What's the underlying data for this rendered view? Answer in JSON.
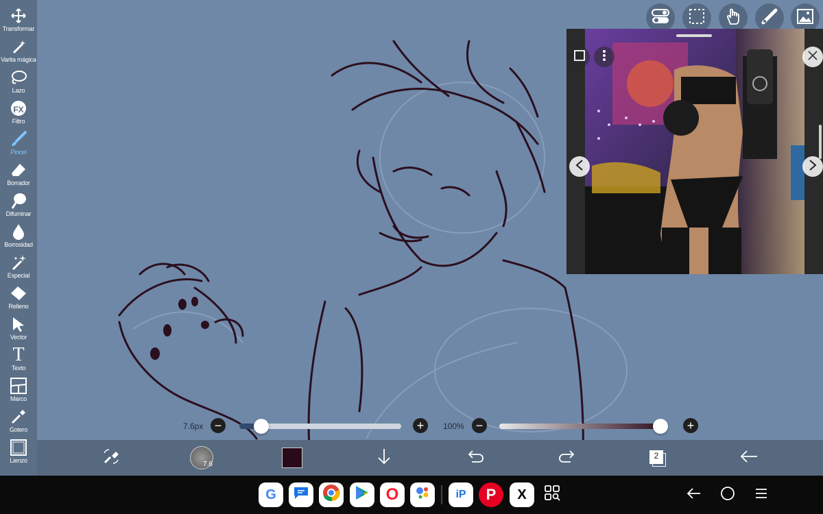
{
  "toolbar": {
    "tools": [
      {
        "label": "Transformar",
        "icon": "move-arrows-icon"
      },
      {
        "label": "Varita mágica",
        "icon": "magic-wand-icon"
      },
      {
        "label": "Lazo",
        "icon": "lasso-icon"
      },
      {
        "label": "Filtro",
        "icon": "fx-icon"
      },
      {
        "label": "Pincel",
        "icon": "brush-icon",
        "active": true
      },
      {
        "label": "Borrador",
        "icon": "eraser-icon"
      },
      {
        "label": "Difuminar",
        "icon": "smudge-icon"
      },
      {
        "label": "Borrosidad",
        "icon": "blur-drop-icon"
      },
      {
        "label": "Especial",
        "icon": "sparkle-icon"
      },
      {
        "label": "Relleno",
        "icon": "fill-bucket-icon"
      },
      {
        "label": "Vector",
        "icon": "vector-arrow-icon"
      },
      {
        "label": "Texto",
        "icon": "text-icon"
      },
      {
        "label": "Marco",
        "icon": "frame-icon"
      },
      {
        "label": "Gotero",
        "icon": "eyedropper-icon"
      },
      {
        "label": "Lienzo",
        "icon": "canvas-icon"
      }
    ],
    "fx_text": "FX",
    "text_glyph": "T"
  },
  "top_tools": [
    "toggle-icon",
    "selection-icon",
    "hand-icon",
    "ruler-icon",
    "image-icon"
  ],
  "sliders": {
    "brush_size": "7.6px",
    "opacity": "100%",
    "brush_size_level": 0.1,
    "opacity_level": 1.0
  },
  "bottombar": {
    "brush_preview_value": "7.6",
    "layer_count": "2",
    "current_color": "#2a0a1a"
  },
  "colors": {
    "toolbar_bg": "#5b6f87",
    "canvas_bg": "#6f88a8",
    "accent": "#7fc5ff",
    "line_art": "#2b0f1e"
  },
  "dock": {
    "apps": [
      {
        "name": "Google",
        "glyph": "G"
      },
      {
        "name": "Messages",
        "glyph": ""
      },
      {
        "name": "Chrome",
        "glyph": ""
      },
      {
        "name": "Play Store",
        "glyph": ""
      },
      {
        "name": "Opera",
        "glyph": "O"
      },
      {
        "name": "Assistant",
        "glyph": ""
      },
      {
        "name": "ibisPaint",
        "glyph": "iP"
      },
      {
        "name": "Pinterest",
        "glyph": "P"
      },
      {
        "name": "X",
        "glyph": "X"
      },
      {
        "name": "App Drawer",
        "glyph": ""
      }
    ]
  },
  "nav": [
    "back-icon",
    "home-icon",
    "recents-icon"
  ]
}
